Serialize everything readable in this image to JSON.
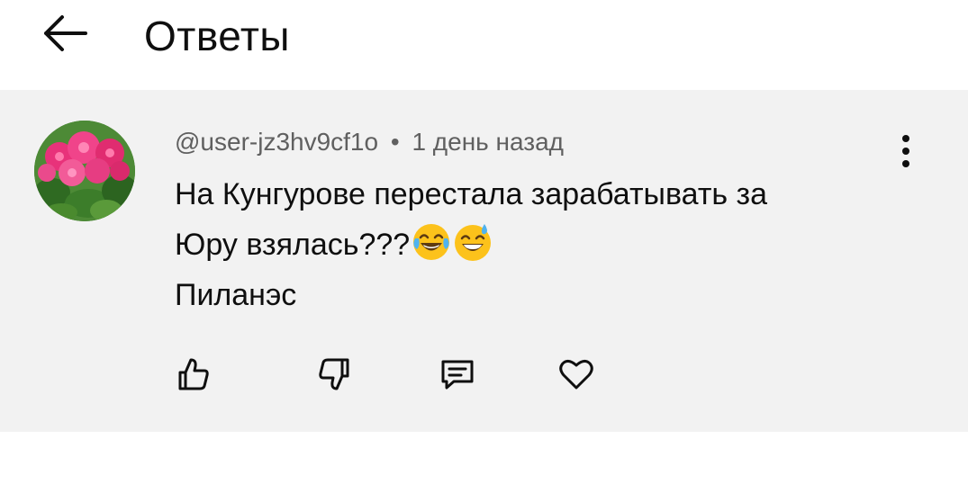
{
  "header": {
    "title": "Ответы"
  },
  "comment": {
    "author": "@user-jz3hv9cf1o",
    "separator": "•",
    "time": "1 день назад",
    "text_line1": "На Кунгурове перестала зарабатывать за",
    "text_line2": "Юру взялась???",
    "text_line3": "Пиланэс",
    "emojis": [
      "tears-of-joy-emoji",
      "grinning-sweat-emoji"
    ]
  },
  "actions": [
    "thumbs-up-icon",
    "thumbs-down-icon",
    "reply-icon",
    "heart-icon"
  ],
  "colors": {
    "comment_bg": "#f2f2f2",
    "meta_text": "#606060",
    "text": "#0f0f0f"
  }
}
